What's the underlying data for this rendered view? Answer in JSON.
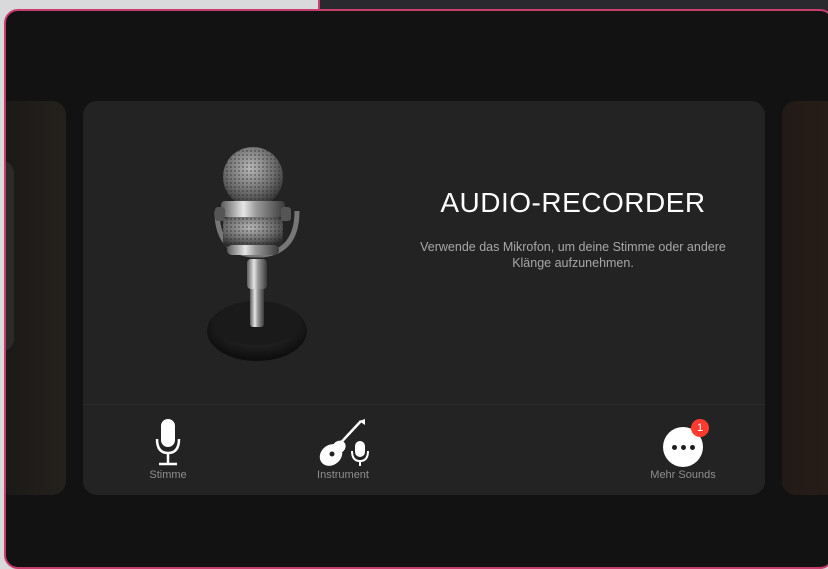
{
  "recorder_card": {
    "title": "AUDIO-RECORDER",
    "description": "Verwende das Mikrofon, um deine Stimme oder andere Klänge aufzunehmen."
  },
  "bottom_buttons": [
    {
      "label": "Stimme",
      "icon": "microphone-icon"
    },
    {
      "label": "Instrument",
      "icon": "guitar-microphone-icon"
    },
    {
      "label": "Mehr Sounds",
      "icon": "more-icon",
      "badge": "1"
    }
  ],
  "colors": {
    "accent_border": "#c83c6e",
    "badge": "#ff3b30",
    "card": "#232323",
    "window_bg": "#121212"
  }
}
